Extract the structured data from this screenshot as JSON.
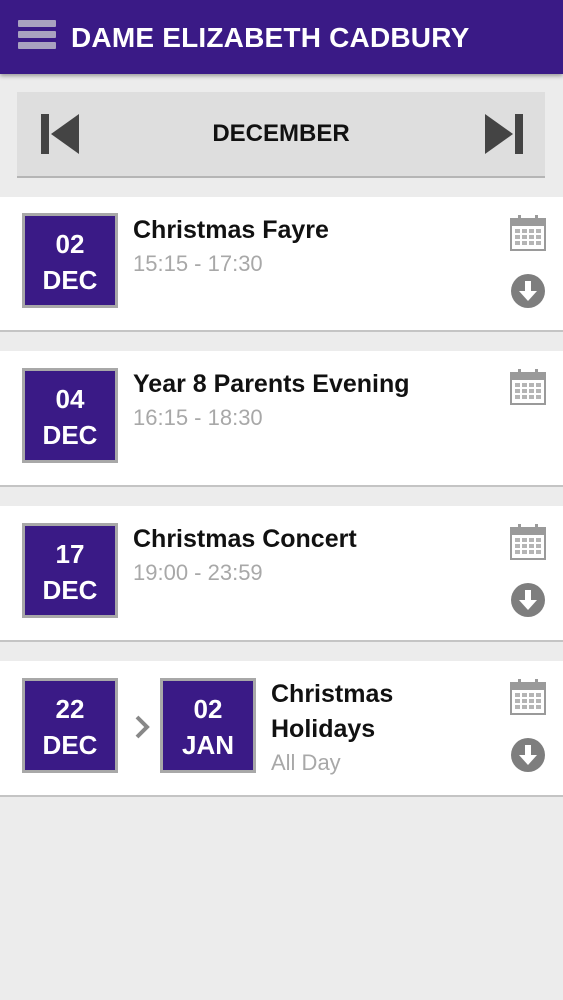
{
  "header": {
    "title": "DAME ELIZABETH CADBURY",
    "menu_icon": "hamburger-menu-icon"
  },
  "month_nav": {
    "month": "DECEMBER",
    "prev_icon": "skip-previous-icon",
    "next_icon": "skip-next-icon"
  },
  "events": [
    {
      "start": {
        "day": "02",
        "month": "DEC"
      },
      "title": "Christmas Fayre",
      "time": "15:15 - 17:30",
      "has_download": true
    },
    {
      "start": {
        "day": "04",
        "month": "DEC"
      },
      "title": "Year 8 Parents Evening",
      "time": "16:15 - 18:30",
      "has_download": false
    },
    {
      "start": {
        "day": "17",
        "month": "DEC"
      },
      "title": "Christmas Concert",
      "time": "19:00 - 23:59",
      "has_download": true
    },
    {
      "start": {
        "day": "22",
        "month": "DEC"
      },
      "end": {
        "day": "02",
        "month": "JAN"
      },
      "title_line1": "Christmas",
      "title_line2": "Holidays",
      "time": "All Day",
      "has_download": true
    }
  ],
  "colors": {
    "header": "#3a1a86",
    "date_box": "#3a1a86",
    "background": "#ececec",
    "icon_gray": "#8a8a8a"
  }
}
